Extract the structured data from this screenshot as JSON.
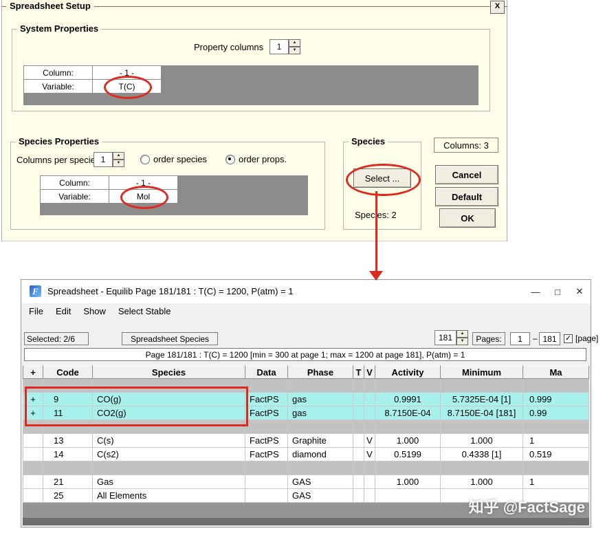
{
  "colors": {
    "dialog_bg": "#fffee8",
    "highlight_row": "#a8f1ed",
    "separator_row": "#c2c2c2",
    "annotation_red": "#de2a1e"
  },
  "setup_dialog": {
    "title": "Spreadsheet Setup",
    "close": "X",
    "system_properties": {
      "legend": "System Properties",
      "property_columns_label": "Property columns",
      "property_columns_value": "1",
      "row1_label": "Column:",
      "row1_value": "- 1 -",
      "row2_label": "Variable:",
      "row2_value": "T(C)"
    },
    "species_properties": {
      "legend": "Species Properties",
      "columns_per_species_label": "Columns per species",
      "columns_per_species_value": "1",
      "order_species_label": "order species",
      "order_props_label": "order props.",
      "row1_label": "Column:",
      "row1_value": "- 1 -",
      "row2_label": "Variable:",
      "row2_value": "Mol"
    },
    "species_box": {
      "legend": "Species",
      "select_button": "Select ...",
      "count_label": "Species:  2"
    },
    "actions": {
      "columns_info": "Columns:  3",
      "cancel": "Cancel",
      "default": "Default",
      "ok": "OK"
    }
  },
  "spreadsheet_window": {
    "title": "Spreadsheet - Equilib   Page 181/181 : T(C) = 1200,  P(atm) = 1",
    "app_icon_glyph": "F",
    "window_controls": {
      "minimize": "—",
      "maximize": "□",
      "close": "✕"
    },
    "menu": [
      "File",
      "Edit",
      "Show",
      "Select Stable"
    ],
    "toolbar": {
      "selected": "Selected: 2/6",
      "species_button": "Spreadsheet Species",
      "page_value": "181",
      "pages_label": "Pages:",
      "from": "1",
      "dash": "–",
      "to": "181",
      "checkbox_glyph": "✓",
      "checkbox_label": "[page]"
    },
    "info_bar": "Page 181/181 : T(C) = 1200 [min = 300 at page 1; max = 1200 at page 181], P(atm) = 1",
    "table": {
      "headers": [
        "+",
        "Code",
        "Species",
        "Data",
        "Phase",
        "T",
        "V",
        "Activity",
        "Minimum",
        "Ma"
      ],
      "rows": [
        {
          "kind": "sep",
          "cells": [
            "",
            "",
            "",
            "",
            "",
            "",
            "",
            "",
            "",
            ""
          ]
        },
        {
          "kind": "hl",
          "cells": [
            "+",
            "9",
            "CO(g)",
            "FactPS",
            "gas",
            "",
            "",
            "0.9991",
            "5.7325E-04 [1]",
            "0.999"
          ]
        },
        {
          "kind": "hl",
          "cells": [
            "+",
            "11",
            "CO2(g)",
            "FactPS",
            "gas",
            "",
            "",
            "8.7150E-04",
            "8.7150E-04 [181]",
            "0.99"
          ]
        },
        {
          "kind": "sep",
          "cells": [
            "",
            "",
            "",
            "",
            "",
            "",
            "",
            "",
            "",
            ""
          ]
        },
        {
          "kind": "",
          "cells": [
            "",
            "13",
            "C(s)",
            "FactPS",
            "Graphite",
            "",
            "V",
            "1.000",
            "1.000",
            "1"
          ]
        },
        {
          "kind": "",
          "cells": [
            "",
            "14",
            "C(s2)",
            "FactPS",
            "diamond",
            "",
            "V",
            "0.5199",
            "0.4338   [1]",
            "0.519"
          ]
        },
        {
          "kind": "sep",
          "cells": [
            "",
            "",
            "",
            "",
            "",
            "",
            "",
            "",
            "",
            ""
          ]
        },
        {
          "kind": "",
          "cells": [
            "",
            "21",
            "Gas",
            "",
            "GAS",
            "",
            "",
            "1.000",
            "1.000",
            "1"
          ]
        },
        {
          "kind": "",
          "cells": [
            "",
            "25",
            "All Elements",
            "",
            "GAS",
            "",
            "",
            "",
            "",
            ""
          ]
        }
      ]
    },
    "watermark": "知乎 @FactSage"
  }
}
